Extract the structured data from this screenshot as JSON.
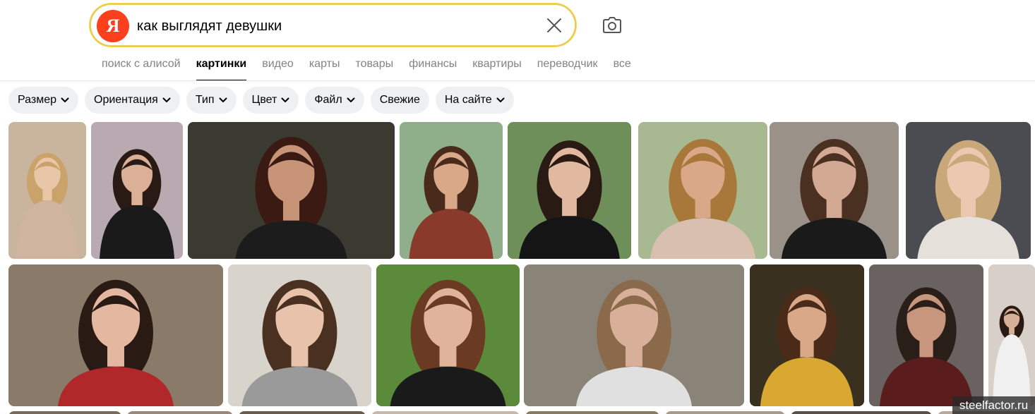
{
  "search": {
    "logo_letter": "Я",
    "query": "как выглядят девушки"
  },
  "tabs": [
    {
      "label": "поиск с алисой",
      "active": false
    },
    {
      "label": "картинки",
      "active": true
    },
    {
      "label": "видео",
      "active": false
    },
    {
      "label": "карты",
      "active": false
    },
    {
      "label": "товары",
      "active": false
    },
    {
      "label": "финансы",
      "active": false
    },
    {
      "label": "квартиры",
      "active": false
    },
    {
      "label": "переводчик",
      "active": false
    },
    {
      "label": "все",
      "active": false
    }
  ],
  "filters": [
    {
      "label": "Размер",
      "dropdown": true
    },
    {
      "label": "Ориентация",
      "dropdown": true
    },
    {
      "label": "Тип",
      "dropdown": true
    },
    {
      "label": "Цвет",
      "dropdown": true
    },
    {
      "label": "Файл",
      "dropdown": true
    },
    {
      "label": "Свежие",
      "dropdown": false
    },
    {
      "label": "На сайте",
      "dropdown": true
    }
  ],
  "results": {
    "row1": [
      {
        "bg": "#c9b59d",
        "hair": "#c9a36a",
        "skin": "#e9c6a8",
        "cloth": "#cfb5a0"
      },
      {
        "bg": "#b9a9b0",
        "hair": "#2a1a16",
        "skin": "#dcb096",
        "cloth": "#1a1a1a"
      },
      {
        "bg": "#3a3a30",
        "hair": "#3a1a12",
        "skin": "#c89478",
        "cloth": "#1c1c1c"
      },
      {
        "bg": "#8fae8a",
        "hair": "#4a2a1a",
        "skin": "#d8a888",
        "cloth": "#8a3a2a"
      },
      {
        "bg": "#6e8f5a",
        "hair": "#2a1a14",
        "skin": "#e0b9a0",
        "cloth": "#151515"
      },
      {
        "bg": "#a8b890",
        "hair": "#a8783a",
        "skin": "#d9a888",
        "cloth": "#d8bfb0"
      },
      {
        "bg": "#9a9288",
        "hair": "#4a3020",
        "skin": "#d4a994",
        "cloth": "#1a1a1a"
      },
      {
        "bg": "#4a4c52",
        "hair": "#c8a878",
        "skin": "#ecc8b0",
        "cloth": "#e6e0da"
      }
    ],
    "row2": [
      {
        "bg": "#8a7a6a",
        "hair": "#2a1a14",
        "skin": "#e4b8a0",
        "cloth": "#b0282a"
      },
      {
        "bg": "#d8d4cc",
        "hair": "#4a3020",
        "skin": "#e8c2aa",
        "cloth": "#9a9a9a"
      },
      {
        "bg": "#5a8a3a",
        "hair": "#6a3a22",
        "skin": "#e0b49a",
        "cloth": "#1a1a1a"
      },
      {
        "bg": "#8a8478",
        "hair": "#8a6a4a",
        "skin": "#d8b09a",
        "cloth": "#e0e0e0"
      },
      {
        "bg": "#3a3020",
        "hair": "#4a2a18",
        "skin": "#d8a888",
        "cloth": "#d8a830"
      },
      {
        "bg": "#6a6260",
        "hair": "#2a1e18",
        "skin": "#c8967c",
        "cloth": "#5a1c1c"
      },
      {
        "bg": "#d8d0c8",
        "hair": "#2a1a14",
        "skin": "#d8b09a",
        "cloth": "#f0f0f0"
      }
    ],
    "row3": [
      {
        "bg": "#7a6a5a"
      },
      {
        "bg": "#9a8878"
      },
      {
        "bg": "#6a5a4a"
      },
      {
        "bg": "#c8b8a8"
      },
      {
        "bg": "#8a7a60"
      },
      {
        "bg": "#a89a8a"
      },
      {
        "bg": "#5a5048"
      },
      {
        "bg": "#b8a898"
      }
    ]
  },
  "watermark": "steelfactor.ru",
  "colors": {
    "logo_red": "#fc3f1d",
    "search_border": "#ffdb4d",
    "chip_bg": "#eef0f3",
    "tab_inactive": "#838383"
  }
}
